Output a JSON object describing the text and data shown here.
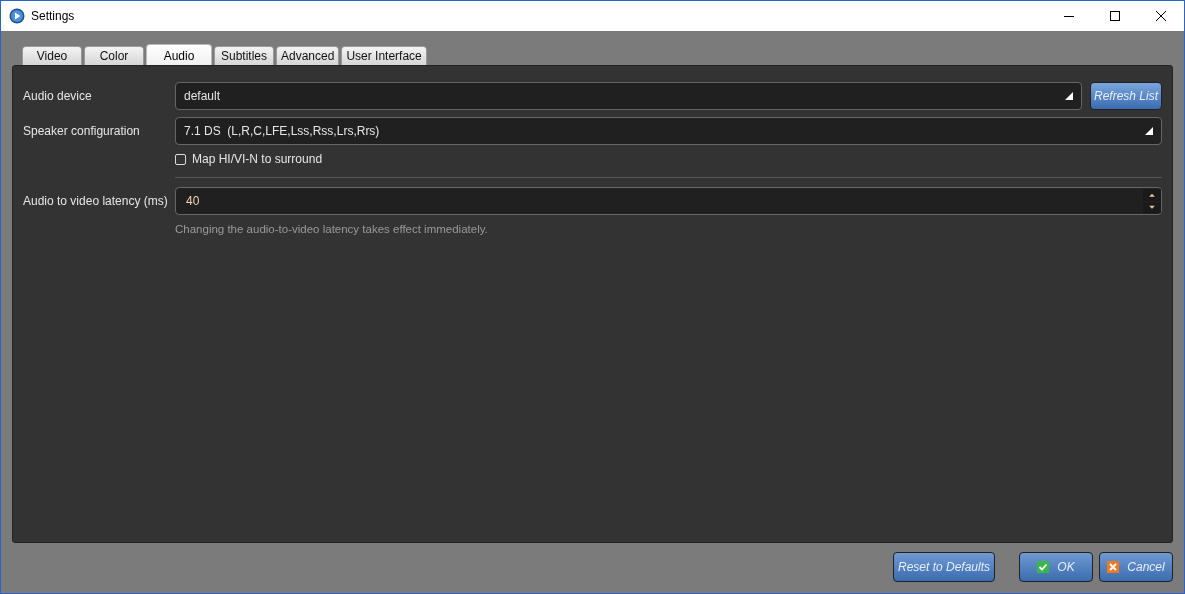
{
  "window": {
    "title": "Settings"
  },
  "tabs": [
    {
      "label": "Video",
      "selected": false
    },
    {
      "label": "Color",
      "selected": false
    },
    {
      "label": "Audio",
      "selected": true
    },
    {
      "label": "Subtitles",
      "selected": false
    },
    {
      "label": "Advanced",
      "selected": false
    },
    {
      "label": "User Interface",
      "selected": false
    }
  ],
  "audio_device": {
    "label": "Audio device",
    "value": "default",
    "button": "Refresh List"
  },
  "speaker_configuration": {
    "label": "Speaker configuration",
    "value": "7.1 DS  (L,R,C,LFE,Lss,Rss,Lrs,Rrs)"
  },
  "map_checkbox": {
    "label": "Map HI/VI-N to surround",
    "checked": false
  },
  "latency": {
    "label": "Audio to video latency (ms)",
    "value": "40",
    "hint": "Changing the audio-to-video latency takes effect immediately."
  },
  "buttons": [
    {
      "label": "Reset to Defaults",
      "kind": "plain"
    },
    {
      "label": "OK",
      "kind": "ok"
    },
    {
      "label": "Cancel",
      "kind": "cancel"
    }
  ]
}
